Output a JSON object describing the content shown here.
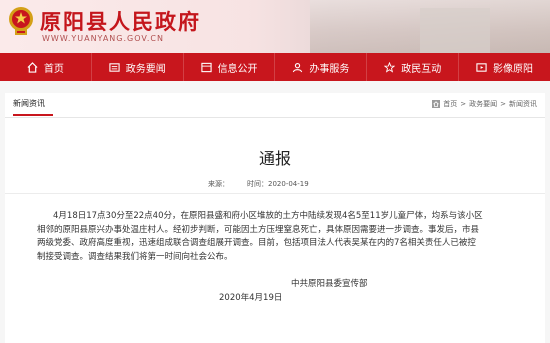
{
  "site": {
    "title": "原阳县人民政府",
    "url": "WWW.YUANYANG.GOV.CN"
  },
  "nav": [
    {
      "label": "首页",
      "icon": "home-icon"
    },
    {
      "label": "政务要闻",
      "icon": "news-icon"
    },
    {
      "label": "信息公开",
      "icon": "info-icon"
    },
    {
      "label": "办事服务",
      "icon": "people-icon"
    },
    {
      "label": "政民互动",
      "icon": "star-icon"
    },
    {
      "label": "影像原阳",
      "icon": "film-icon"
    }
  ],
  "section": {
    "tab": "新闻资讯"
  },
  "breadcrumb": {
    "home": "首页",
    "sep": ">",
    "level1": "政务要闻",
    "level2": "新闻资讯"
  },
  "article": {
    "title": "通报",
    "source_label": "来源：",
    "time_label": "时间：2020-04-19",
    "body": "4月18日17点30分至22点40分，在原阳县盛和府小区堆放的土方中陆续发现4名5至11岁儿童尸体，均系与该小区相邻的原阳县原兴办事处温庄村人。经初步判断，可能因土方压埋窒息死亡，具体原因需要进一步调查。事发后，市县两级党委、政府高度重视，迅速组成联合调查组展开调查。目前，包括项目法人代表吴某在内的7名相关责任人已被控制接受调查。调查结果我们将第一时间向社会公布。",
    "signature": "中共原阳县委宣传部",
    "date": "2020年4月19日"
  },
  "colors": {
    "brand_red": "#c8161d",
    "title_red": "#c4161c"
  }
}
